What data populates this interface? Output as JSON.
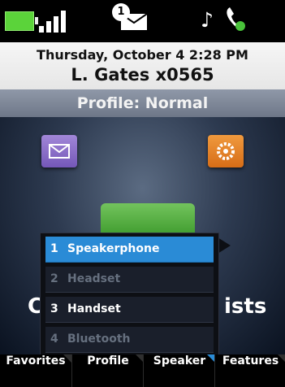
{
  "status_bar": {
    "message_count": "1",
    "icons": [
      "battery-icon",
      "signal-icon",
      "message-icon",
      "music-note-icon",
      "phone-status-icon"
    ]
  },
  "header": {
    "datetime": "Thursday, October 4 2:28 PM",
    "user": "L. Gates x0565"
  },
  "profile_bar": {
    "label": "Profile: Normal"
  },
  "home": {
    "icons": [
      "messages-icon",
      "settings-icon"
    ],
    "background_text_left": "C",
    "background_text_right": "ists"
  },
  "audio_menu": {
    "items": [
      {
        "num": "1",
        "label": "Speakerphone",
        "state": "selected"
      },
      {
        "num": "2",
        "label": "Headset",
        "state": "disabled"
      },
      {
        "num": "3",
        "label": "Handset",
        "state": "enabled"
      },
      {
        "num": "4",
        "label": "Bluetooth",
        "state": "disabled"
      }
    ]
  },
  "softkeys": [
    {
      "label": "Favorites"
    },
    {
      "label": "Profile"
    },
    {
      "label": "Speaker",
      "active": true
    },
    {
      "label": "Features"
    }
  ],
  "colors": {
    "selected": "#2a8bd6",
    "battery": "#5bd33a",
    "profile_bar": "#7c8596"
  }
}
